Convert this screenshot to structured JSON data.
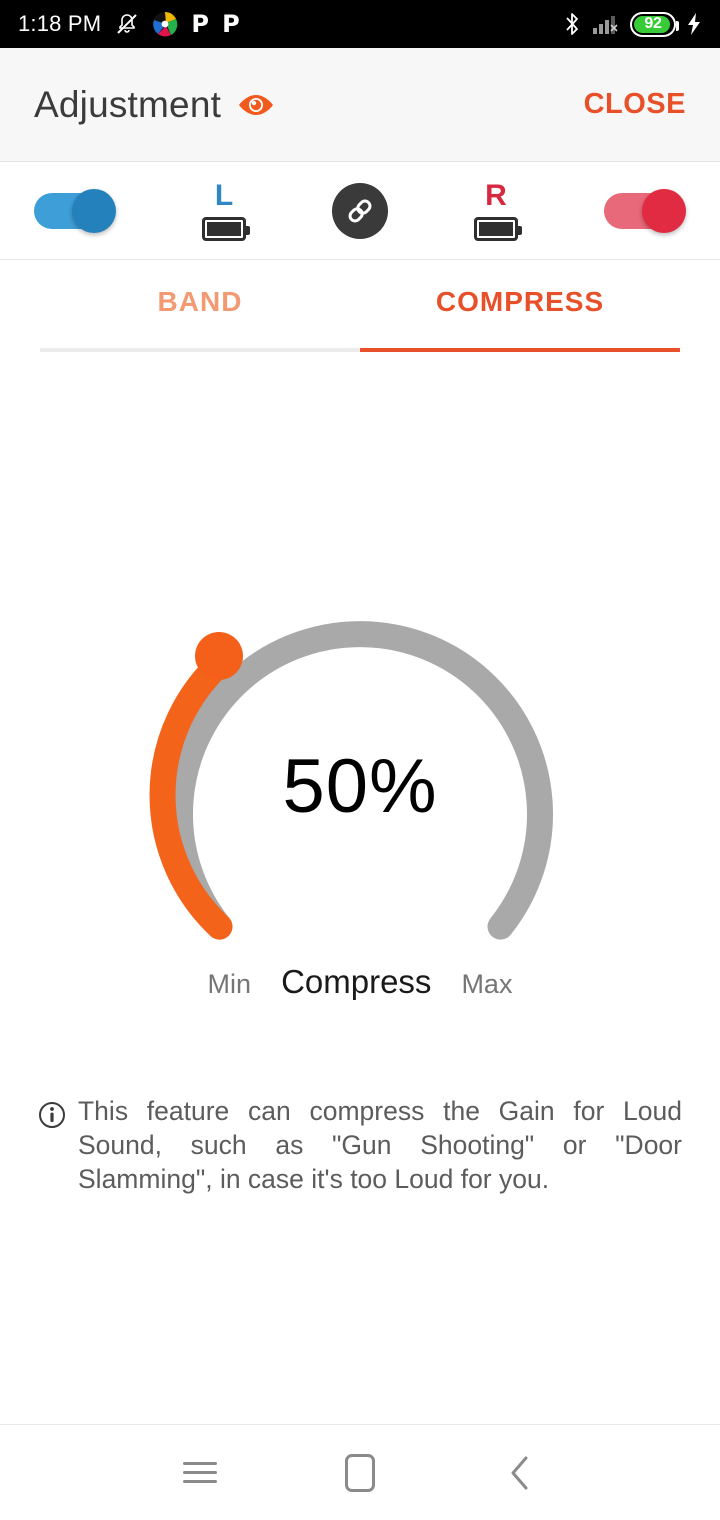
{
  "status_bar": {
    "time": "1:18 PM",
    "left_icons": [
      "mute-bell-icon",
      "colorful-app-icon",
      "p-app-icon",
      "p-app-icon-2"
    ],
    "right_icons": [
      "bluetooth-icon",
      "signal-icon",
      "battery-icon",
      "charging-bolt-icon"
    ],
    "battery_level": "92",
    "battery_color": "#37cc37"
  },
  "app_bar": {
    "title": "Adjustment",
    "eye_icon": "eye-icon",
    "close_label": "CLOSE",
    "accent_color": "#E8502A",
    "background": "#f7f7f7"
  },
  "device_row": {
    "left_toggle": {
      "name": "left-device-toggle",
      "state": "on",
      "track_color": "#3e9fd8",
      "thumb_color": "#2581bb"
    },
    "right_toggle": {
      "name": "right-device-toggle",
      "state": "on",
      "track_color": "#e8697a",
      "thumb_color": "#e02b42"
    },
    "left_side": {
      "letter": "L",
      "color": "#2f88c4",
      "battery_icon": "battery-full-icon"
    },
    "right_side": {
      "letter": "R",
      "color": "#d8283f",
      "battery_icon": "battery-full-icon"
    },
    "link_button": {
      "name": "link-devices-button",
      "icon": "chain-link-icon",
      "background": "#3a3a3a"
    }
  },
  "tabs": {
    "items": [
      {
        "label": "BAND",
        "active": false,
        "color": "#f39a72"
      },
      {
        "label": "COMPRESS",
        "active": true,
        "color": "#E8502A"
      }
    ],
    "active_index": 1,
    "indicator_color": "#E8502A",
    "inactive_indicator_color": "#ececec"
  },
  "gauge": {
    "value_label": "50%",
    "title": "Compress",
    "min_label": "Min",
    "max_label": "Max",
    "track_color": "#a9a9a9",
    "progress_color": "#f4631a",
    "handle_color": "#f4601a",
    "value_text_color": "#000000"
  },
  "chart_data": {
    "type": "gauge",
    "title": "Compress",
    "value": 50,
    "unit": "%",
    "min": 0,
    "max": 100,
    "min_label": "Min",
    "max_label": "Max",
    "arc_start_deg": 140,
    "arc_sweep_deg": 260,
    "track_color": "#a9a9a9",
    "progress_color": "#f4631a"
  },
  "info": {
    "icon": "info-circle-icon",
    "text": "This feature can compress the Gain for Loud Sound, such as \"Gun Shooting\" or \"Door Slamming\", in case it's too Loud for you."
  },
  "nav_bar": {
    "items": [
      {
        "name": "recents-button",
        "icon": "hamburger-icon"
      },
      {
        "name": "home-button",
        "icon": "home-square-icon"
      },
      {
        "name": "back-button",
        "icon": "chevron-left-icon"
      }
    ],
    "icon_color": "#8a8a8a"
  }
}
